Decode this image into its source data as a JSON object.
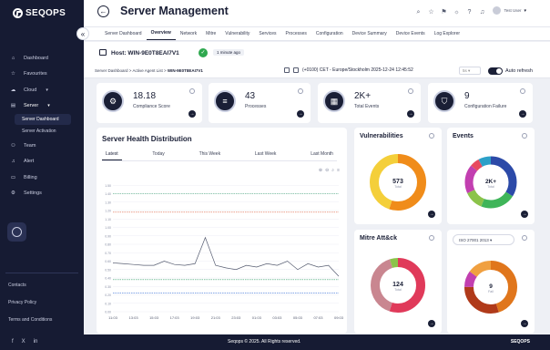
{
  "brand": {
    "name": "SEQOPS"
  },
  "sidebar": {
    "items": [
      {
        "label": "Dashboard",
        "icon": "home-icon"
      },
      {
        "label": "Favourites",
        "icon": "star-icon"
      },
      {
        "label": "Cloud",
        "icon": "cloud-icon"
      },
      {
        "label": "Server",
        "icon": "server-icon"
      },
      {
        "label": "Team",
        "icon": "team-icon"
      },
      {
        "label": "Alert",
        "icon": "bell-icon"
      },
      {
        "label": "Billing",
        "icon": "billing-icon"
      },
      {
        "label": "Settings",
        "icon": "gear-icon"
      }
    ],
    "subitems": [
      {
        "label": "Server Dashboard"
      },
      {
        "label": "Server Activation"
      }
    ],
    "links": [
      "Contacts",
      "Privacy Policy",
      "Terms and Conditions"
    ]
  },
  "header": {
    "title": "Server Management",
    "user_name": "Test User"
  },
  "tabs": [
    {
      "label": "Server Dashboard",
      "active": false
    },
    {
      "label": "Overview",
      "active": true
    },
    {
      "label": "Network",
      "active": false
    },
    {
      "label": "Mitre",
      "active": false
    },
    {
      "label": "Vulnerability",
      "active": false
    },
    {
      "label": "Services",
      "active": false
    },
    {
      "label": "Processes",
      "active": false
    },
    {
      "label": "Configuration",
      "active": false
    },
    {
      "label": "Device Summary",
      "active": false
    },
    {
      "label": "Device Events",
      "active": false
    },
    {
      "label": "Log Explorer",
      "active": false
    }
  ],
  "host": {
    "label": "Host: WIN-9E0T8EAI7V1",
    "last_seen": "1 minute ago"
  },
  "breadcrumb": {
    "part1": "Server Dashboard",
    "sep": ">",
    "part2": "Active Agent List",
    "current": "WIN-9E0T8EAI7V1"
  },
  "timezone": {
    "text": "(+0100) CET - Europe/Stockholm 2025-12-24 12:45:52"
  },
  "zoom_select": {
    "value": "5s"
  },
  "auto_refresh": {
    "label": "Auto refresh",
    "on": true
  },
  "stats": [
    {
      "value": "18.18",
      "label": "Compliance Score",
      "icon": "compliance-icon"
    },
    {
      "value": "43",
      "label": "Processes",
      "icon": "processes-icon"
    },
    {
      "value": "2K+",
      "label": "Total Events",
      "icon": "events-icon"
    },
    {
      "value": "9",
      "label": "Configuration Failure",
      "icon": "config-icon"
    }
  ],
  "health": {
    "title": "Server Health Distribution",
    "tabs": [
      "Latest",
      "Today",
      "This Week",
      "Last Week",
      "Last Month"
    ],
    "active_tab": "Latest"
  },
  "chart_data": {
    "type": "line",
    "x": [
      "11:03",
      "12:03",
      "13:03",
      "14:03",
      "15:03",
      "16:03",
      "17:03",
      "18:03",
      "19:03",
      "20:03",
      "21:03",
      "22:03",
      "23:03",
      "00:03",
      "01:03",
      "02:03",
      "03:03",
      "04:03",
      "05:03",
      "06:03",
      "07:03",
      "08:03",
      "09:03"
    ],
    "ylim": [
      0,
      1.6
    ],
    "yticks": [
      "0.00",
      "0.10",
      "0.20",
      "0.30",
      "0.40",
      "0.50",
      "0.60",
      "0.70",
      "0.80",
      "0.90",
      "1.00",
      "1.10",
      "1.20",
      "1.30",
      "1.40",
      "1.50"
    ],
    "series": [
      {
        "color": "#e06a4a",
        "values": [
          1.18,
          1.18,
          1.18,
          1.18,
          1.18,
          1.18,
          1.18,
          1.18,
          1.18,
          1.18,
          1.18,
          1.18,
          1.18,
          1.18,
          1.18,
          1.18,
          1.18,
          1.18,
          1.18,
          1.18,
          1.18,
          1.18,
          1.18
        ]
      },
      {
        "color": "#35a06a",
        "values": [
          1.4,
          1.4,
          1.4,
          1.4,
          1.4,
          1.4,
          1.4,
          1.4,
          1.4,
          1.4,
          1.4,
          1.4,
          1.4,
          1.4,
          1.4,
          1.4,
          1.4,
          1.4,
          1.4,
          1.4,
          1.4,
          1.4,
          1.4
        ]
      },
      {
        "color": "#555b70",
        "values": [
          0.58,
          0.57,
          0.56,
          0.55,
          0.55,
          0.6,
          0.56,
          0.55,
          0.57,
          0.88,
          0.55,
          0.52,
          0.5,
          0.55,
          0.53,
          0.57,
          0.55,
          0.6,
          0.5,
          0.57,
          0.53,
          0.55,
          0.42
        ]
      },
      {
        "color": "#3b6fd6",
        "values": [
          0.22,
          0.22,
          0.22,
          0.22,
          0.22,
          0.22,
          0.22,
          0.22,
          0.22,
          0.22,
          0.22,
          0.22,
          0.22,
          0.22,
          0.22,
          0.22,
          0.22,
          0.22,
          0.22,
          0.22,
          0.22,
          0.22,
          0.22
        ]
      },
      {
        "color": "#35a06a",
        "values": [
          0.38,
          0.38,
          0.38,
          0.38,
          0.38,
          0.38,
          0.38,
          0.38,
          0.38,
          0.38,
          0.38,
          0.38,
          0.38,
          0.38,
          0.38,
          0.38,
          0.38,
          0.38,
          0.38,
          0.38,
          0.38,
          0.38,
          0.38
        ]
      }
    ]
  },
  "vulnerabilities": {
    "title": "Vulnerabilities",
    "value": "573",
    "sub": "Total",
    "slices": [
      {
        "v": 0.55,
        "c": "#f08c1a"
      },
      {
        "v": 0.45,
        "c": "#f4cf3a"
      }
    ]
  },
  "events": {
    "title": "Events",
    "value": "2K+",
    "sub": "Total",
    "slices": [
      {
        "v": 0.34,
        "c": "#2c4aa8"
      },
      {
        "v": 0.22,
        "c": "#3fb559"
      },
      {
        "v": 0.12,
        "c": "#8bc34a"
      },
      {
        "v": 0.18,
        "c": "#c23fb0"
      },
      {
        "v": 0.06,
        "c": "#e84a5f"
      },
      {
        "v": 0.08,
        "c": "#2ca0c8"
      }
    ]
  },
  "mitre": {
    "title": "Mitre Att&ck",
    "value": "124",
    "sub": "Total",
    "slices": [
      {
        "v": 0.55,
        "c": "#e03a5a"
      },
      {
        "v": 0.4,
        "c": "#c98690"
      },
      {
        "v": 0.05,
        "c": "#8bc34a"
      }
    ]
  },
  "compliance": {
    "select": "ISO 27001 2013",
    "value": "9",
    "sub": "Fail",
    "slices": [
      {
        "v": 0.45,
        "c": "#e0761c"
      },
      {
        "v": 0.3,
        "c": "#b03a1a"
      },
      {
        "v": 0.1,
        "c": "#c23fb0"
      },
      {
        "v": 0.15,
        "c": "#f0a040"
      }
    ]
  },
  "footer": {
    "copyright": "Seqops © 2025. All Rights reserved.",
    "brand": "SEQOPS"
  }
}
